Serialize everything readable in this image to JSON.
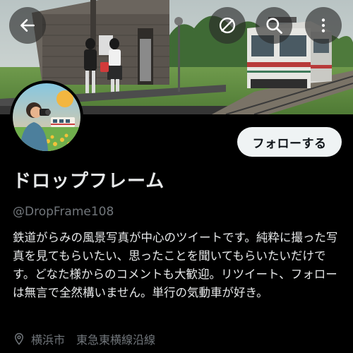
{
  "header": {
    "back_icon": "arrow-left-icon",
    "hide_icon": "eye-slash-circle-icon",
    "search_icon": "search-icon",
    "more_icon": "more-vertical-icon"
  },
  "profile": {
    "display_name": "ドロップフレーム",
    "handle": "@DropFrame108",
    "follow_label": "フォローする",
    "bio": "鉄道がらみの風景写真が中心のツイートです。純粋に撮った写真を見てもらいたい、思ったことを聞いてもらいたいだけです。どなた様からのコメントも大歓迎。リツイート、フォローは無言で全然構いません。単行の気動車が好き。",
    "location": "横浜市　東急東横線沿線",
    "location_icon": "location-pin-icon"
  },
  "colors": {
    "background": "#000000",
    "follow_button_bg": "#eff3f4",
    "follow_button_text": "#0f1419",
    "secondary_text": "#71767b",
    "primary_text": "#e7e9ea"
  }
}
